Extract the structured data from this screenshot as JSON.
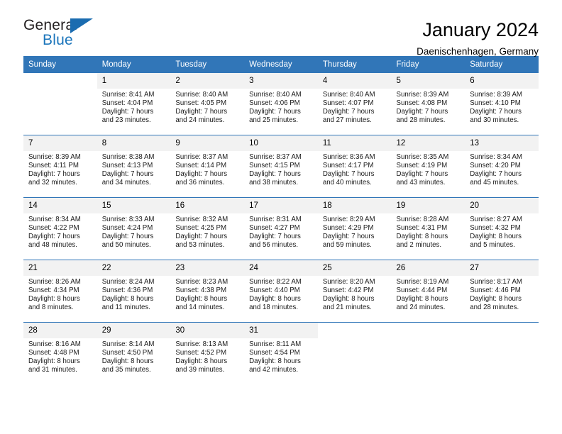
{
  "brand": {
    "name_part1": "General",
    "name_part2": "Blue",
    "triangle_color": "#1b6cb0",
    "blue_color": "#1b75bb"
  },
  "header": {
    "title": "January 2024",
    "subtitle": "Daenischenhagen, Germany",
    "header_bg": "#3176b8",
    "daynum_bg": "#f2f2f2"
  },
  "weekdays": [
    "Sunday",
    "Monday",
    "Tuesday",
    "Wednesday",
    "Thursday",
    "Friday",
    "Saturday"
  ],
  "weeks": [
    [
      {
        "day": "",
        "sunrise": "",
        "sunset": "",
        "daylight_line1": "",
        "daylight_line2": "",
        "blank": true
      },
      {
        "day": "1",
        "sunrise": "Sunrise: 8:41 AM",
        "sunset": "Sunset: 4:04 PM",
        "daylight_line1": "Daylight: 7 hours",
        "daylight_line2": "and 23 minutes."
      },
      {
        "day": "2",
        "sunrise": "Sunrise: 8:40 AM",
        "sunset": "Sunset: 4:05 PM",
        "daylight_line1": "Daylight: 7 hours",
        "daylight_line2": "and 24 minutes."
      },
      {
        "day": "3",
        "sunrise": "Sunrise: 8:40 AM",
        "sunset": "Sunset: 4:06 PM",
        "daylight_line1": "Daylight: 7 hours",
        "daylight_line2": "and 25 minutes."
      },
      {
        "day": "4",
        "sunrise": "Sunrise: 8:40 AM",
        "sunset": "Sunset: 4:07 PM",
        "daylight_line1": "Daylight: 7 hours",
        "daylight_line2": "and 27 minutes."
      },
      {
        "day": "5",
        "sunrise": "Sunrise: 8:39 AM",
        "sunset": "Sunset: 4:08 PM",
        "daylight_line1": "Daylight: 7 hours",
        "daylight_line2": "and 28 minutes."
      },
      {
        "day": "6",
        "sunrise": "Sunrise: 8:39 AM",
        "sunset": "Sunset: 4:10 PM",
        "daylight_line1": "Daylight: 7 hours",
        "daylight_line2": "and 30 minutes."
      }
    ],
    [
      {
        "day": "7",
        "sunrise": "Sunrise: 8:39 AM",
        "sunset": "Sunset: 4:11 PM",
        "daylight_line1": "Daylight: 7 hours",
        "daylight_line2": "and 32 minutes."
      },
      {
        "day": "8",
        "sunrise": "Sunrise: 8:38 AM",
        "sunset": "Sunset: 4:13 PM",
        "daylight_line1": "Daylight: 7 hours",
        "daylight_line2": "and 34 minutes."
      },
      {
        "day": "9",
        "sunrise": "Sunrise: 8:37 AM",
        "sunset": "Sunset: 4:14 PM",
        "daylight_line1": "Daylight: 7 hours",
        "daylight_line2": "and 36 minutes."
      },
      {
        "day": "10",
        "sunrise": "Sunrise: 8:37 AM",
        "sunset": "Sunset: 4:15 PM",
        "daylight_line1": "Daylight: 7 hours",
        "daylight_line2": "and 38 minutes."
      },
      {
        "day": "11",
        "sunrise": "Sunrise: 8:36 AM",
        "sunset": "Sunset: 4:17 PM",
        "daylight_line1": "Daylight: 7 hours",
        "daylight_line2": "and 40 minutes."
      },
      {
        "day": "12",
        "sunrise": "Sunrise: 8:35 AM",
        "sunset": "Sunset: 4:19 PM",
        "daylight_line1": "Daylight: 7 hours",
        "daylight_line2": "and 43 minutes."
      },
      {
        "day": "13",
        "sunrise": "Sunrise: 8:34 AM",
        "sunset": "Sunset: 4:20 PM",
        "daylight_line1": "Daylight: 7 hours",
        "daylight_line2": "and 45 minutes."
      }
    ],
    [
      {
        "day": "14",
        "sunrise": "Sunrise: 8:34 AM",
        "sunset": "Sunset: 4:22 PM",
        "daylight_line1": "Daylight: 7 hours",
        "daylight_line2": "and 48 minutes."
      },
      {
        "day": "15",
        "sunrise": "Sunrise: 8:33 AM",
        "sunset": "Sunset: 4:24 PM",
        "daylight_line1": "Daylight: 7 hours",
        "daylight_line2": "and 50 minutes."
      },
      {
        "day": "16",
        "sunrise": "Sunrise: 8:32 AM",
        "sunset": "Sunset: 4:25 PM",
        "daylight_line1": "Daylight: 7 hours",
        "daylight_line2": "and 53 minutes."
      },
      {
        "day": "17",
        "sunrise": "Sunrise: 8:31 AM",
        "sunset": "Sunset: 4:27 PM",
        "daylight_line1": "Daylight: 7 hours",
        "daylight_line2": "and 56 minutes."
      },
      {
        "day": "18",
        "sunrise": "Sunrise: 8:29 AM",
        "sunset": "Sunset: 4:29 PM",
        "daylight_line1": "Daylight: 7 hours",
        "daylight_line2": "and 59 minutes."
      },
      {
        "day": "19",
        "sunrise": "Sunrise: 8:28 AM",
        "sunset": "Sunset: 4:31 PM",
        "daylight_line1": "Daylight: 8 hours",
        "daylight_line2": "and 2 minutes."
      },
      {
        "day": "20",
        "sunrise": "Sunrise: 8:27 AM",
        "sunset": "Sunset: 4:32 PM",
        "daylight_line1": "Daylight: 8 hours",
        "daylight_line2": "and 5 minutes."
      }
    ],
    [
      {
        "day": "21",
        "sunrise": "Sunrise: 8:26 AM",
        "sunset": "Sunset: 4:34 PM",
        "daylight_line1": "Daylight: 8 hours",
        "daylight_line2": "and 8 minutes."
      },
      {
        "day": "22",
        "sunrise": "Sunrise: 8:24 AM",
        "sunset": "Sunset: 4:36 PM",
        "daylight_line1": "Daylight: 8 hours",
        "daylight_line2": "and 11 minutes."
      },
      {
        "day": "23",
        "sunrise": "Sunrise: 8:23 AM",
        "sunset": "Sunset: 4:38 PM",
        "daylight_line1": "Daylight: 8 hours",
        "daylight_line2": "and 14 minutes."
      },
      {
        "day": "24",
        "sunrise": "Sunrise: 8:22 AM",
        "sunset": "Sunset: 4:40 PM",
        "daylight_line1": "Daylight: 8 hours",
        "daylight_line2": "and 18 minutes."
      },
      {
        "day": "25",
        "sunrise": "Sunrise: 8:20 AM",
        "sunset": "Sunset: 4:42 PM",
        "daylight_line1": "Daylight: 8 hours",
        "daylight_line2": "and 21 minutes."
      },
      {
        "day": "26",
        "sunrise": "Sunrise: 8:19 AM",
        "sunset": "Sunset: 4:44 PM",
        "daylight_line1": "Daylight: 8 hours",
        "daylight_line2": "and 24 minutes."
      },
      {
        "day": "27",
        "sunrise": "Sunrise: 8:17 AM",
        "sunset": "Sunset: 4:46 PM",
        "daylight_line1": "Daylight: 8 hours",
        "daylight_line2": "and 28 minutes."
      }
    ],
    [
      {
        "day": "28",
        "sunrise": "Sunrise: 8:16 AM",
        "sunset": "Sunset: 4:48 PM",
        "daylight_line1": "Daylight: 8 hours",
        "daylight_line2": "and 31 minutes."
      },
      {
        "day": "29",
        "sunrise": "Sunrise: 8:14 AM",
        "sunset": "Sunset: 4:50 PM",
        "daylight_line1": "Daylight: 8 hours",
        "daylight_line2": "and 35 minutes."
      },
      {
        "day": "30",
        "sunrise": "Sunrise: 8:13 AM",
        "sunset": "Sunset: 4:52 PM",
        "daylight_line1": "Daylight: 8 hours",
        "daylight_line2": "and 39 minutes."
      },
      {
        "day": "31",
        "sunrise": "Sunrise: 8:11 AM",
        "sunset": "Sunset: 4:54 PM",
        "daylight_line1": "Daylight: 8 hours",
        "daylight_line2": "and 42 minutes."
      },
      {
        "day": "",
        "sunrise": "",
        "sunset": "",
        "daylight_line1": "",
        "daylight_line2": "",
        "blank": true
      },
      {
        "day": "",
        "sunrise": "",
        "sunset": "",
        "daylight_line1": "",
        "daylight_line2": "",
        "blank": true
      },
      {
        "day": "",
        "sunrise": "",
        "sunset": "",
        "daylight_line1": "",
        "daylight_line2": "",
        "blank": true
      }
    ]
  ]
}
